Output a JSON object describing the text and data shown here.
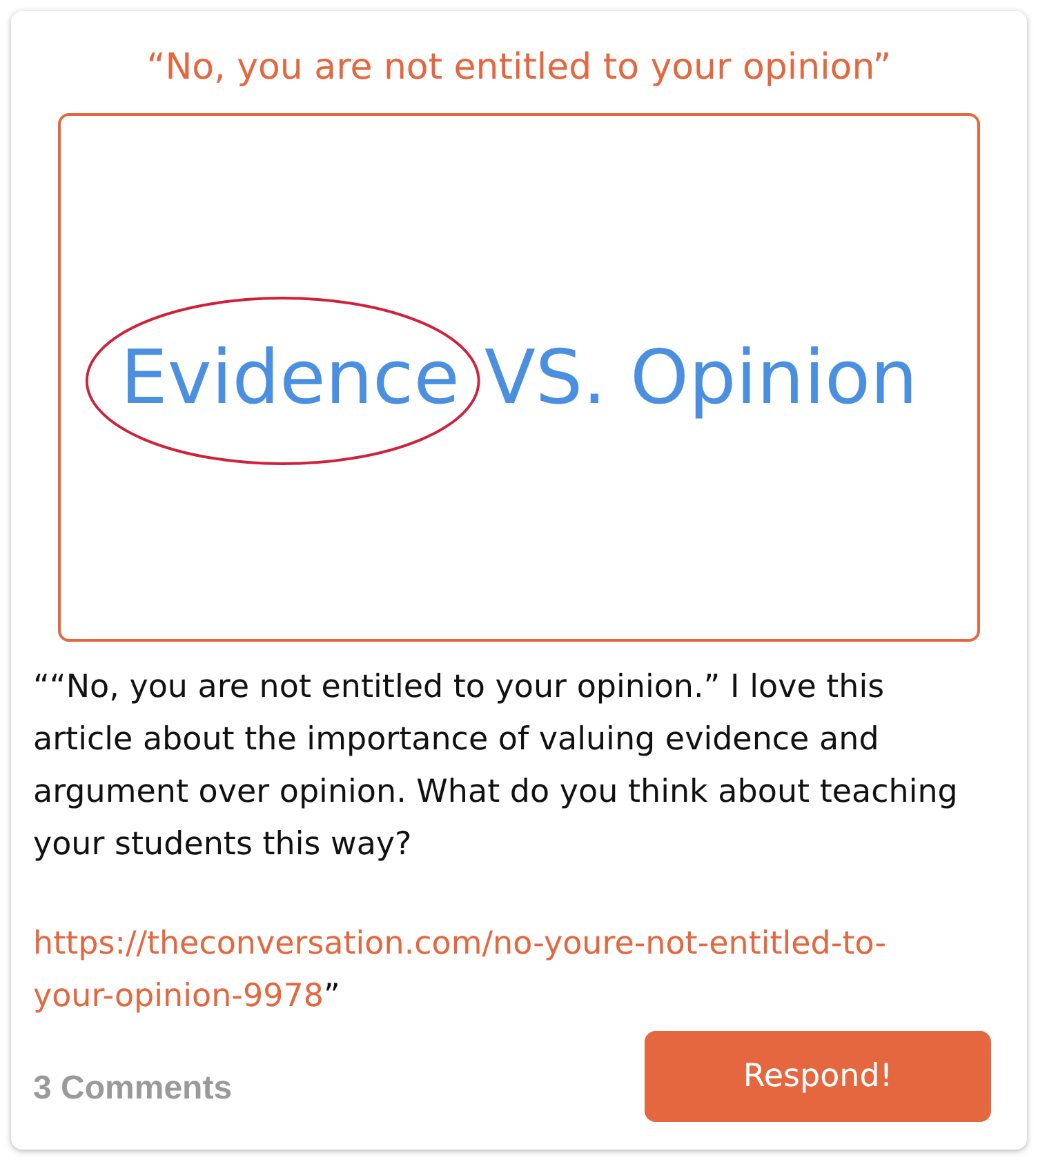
{
  "title": "“No, you are not entitled to your opinion”",
  "image": {
    "words": [
      {
        "text": "Evidence",
        "circled": true
      },
      {
        "text": "VS. Opinion",
        "circled": false
      }
    ]
  },
  "body": "““No, you are not entitled to your opinion.” I love this article about the importance of valuing evidence and argument over opinion. What do you think about teaching your students this way?",
  "link_lines": [
    "https://theconversation.com/no-youre-not-entitled-to-",
    "your-opinion-9978"
  ],
  "link_suffix": "”",
  "comments": "3 Comments",
  "respond_button": "Respond!"
}
